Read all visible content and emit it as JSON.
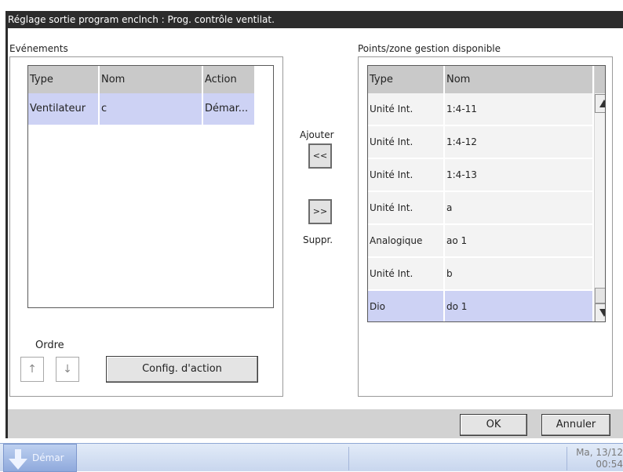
{
  "dialog": {
    "title": "Réglage sortie program enclnch : Prog. contrôle ventilat."
  },
  "events": {
    "label": "Evénements",
    "columns": [
      "Type",
      "Nom",
      "Action"
    ],
    "rows": [
      {
        "type": "Ventilateur",
        "name": "c",
        "action": "Démar..."
      }
    ],
    "order_label": "Ordre",
    "up_glyph": "↑",
    "down_glyph": "↓",
    "config_button": "Config. d'action"
  },
  "transfer": {
    "add_label": "Ajouter",
    "add_button": "<<",
    "remove_button": ">>",
    "remove_label": "Suppr."
  },
  "points": {
    "label": "Points/zone gestion disponible",
    "columns": [
      "Type",
      "Nom"
    ],
    "rows": [
      {
        "type": "Unité Int.",
        "name": "1:4-11"
      },
      {
        "type": "Unité Int.",
        "name": "1:4-12"
      },
      {
        "type": "Unité Int.",
        "name": "1:4-13"
      },
      {
        "type": "Unité Int.",
        "name": "a"
      },
      {
        "type": "Analogique",
        "name": "ao 1"
      },
      {
        "type": "Unité Int.",
        "name": "b"
      },
      {
        "type": "Dio",
        "name": "do 1"
      }
    ],
    "selected_index": 6
  },
  "footer": {
    "ok": "OK",
    "cancel": "Annuler"
  },
  "taskbar": {
    "start_label": "Démar",
    "clock_date": "Ma, 13/12",
    "clock_time": "00:54"
  },
  "colors": {
    "selection": "#cdd2f4",
    "header": "#c9c9c9",
    "title_bar": "#2c2c2c"
  },
  "icons": {
    "scroll_up": "triangle-up-icon",
    "scroll_down": "triangle-down-icon",
    "start": "arrow-down-icon"
  }
}
